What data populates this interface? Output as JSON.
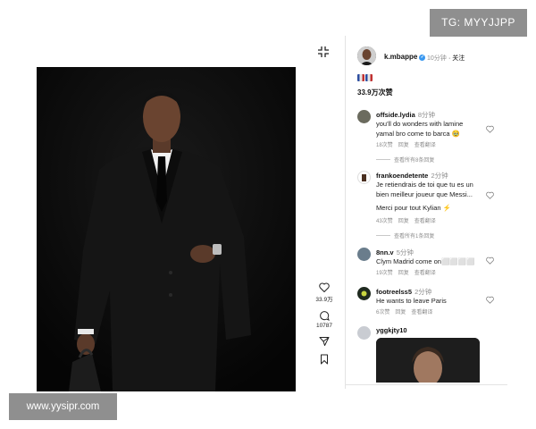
{
  "watermarks": {
    "top": "TG: MYYJJPP",
    "bottom": "www.yysipr.com"
  },
  "post": {
    "image": "man-in-black-suit-photo",
    "next_icon": "chevron-right-icon",
    "collapse_icon": "collapse-icon"
  },
  "actions": {
    "like_count": "33.9万",
    "comment_count": "10787",
    "icons": [
      "heart-icon",
      "comment-icon",
      "share-icon",
      "bookmark-icon"
    ]
  },
  "author": {
    "username": "k.mbappe",
    "time": "10分钟",
    "follow_label": "· 关注",
    "verified": true
  },
  "caption_emojis": [
    "flag-emoji",
    "flag-emoji"
  ],
  "likes_text": "33.9万次赞",
  "comments": [
    {
      "username": "offside.lydia",
      "time": "8分钟",
      "lines": [
        "you'll do wonders with lamine",
        "yamal bro come to barca 🥹"
      ],
      "likes": "18次赞",
      "reply": "回复",
      "translate": "查看翻译",
      "view_replies": "查看所有8条回复"
    },
    {
      "username": "frankoendetente",
      "time": "2分钟",
      "lines": [
        "Je retiendrais de toi que tu es un",
        "bien meilleur joueur que Messi...",
        "",
        "Merci pour tout Kylian ⚡"
      ],
      "likes": "43次赞",
      "reply": "回复",
      "translate": "查看翻译",
      "view_replies": "查看所有1条回复"
    },
    {
      "username": "8nn.v",
      "time": "5分钟",
      "lines": [
        "Clym Madrid come on⬜⬜⬜⬜"
      ],
      "likes": "19次赞",
      "reply": "回复",
      "translate": "查看翻译"
    },
    {
      "username": "footreelss5",
      "time": "2分钟",
      "lines": [
        "He wants to leave Paris"
      ],
      "likes": "6次赞",
      "reply": "回复",
      "translate": "查看翻译"
    },
    {
      "username": "yggkjty10",
      "image": "man-portrait-photo"
    }
  ],
  "colors": {
    "verified": "#3897f0",
    "meta": "#8e8e8e",
    "watermark_bg": "#8f8f8f"
  }
}
